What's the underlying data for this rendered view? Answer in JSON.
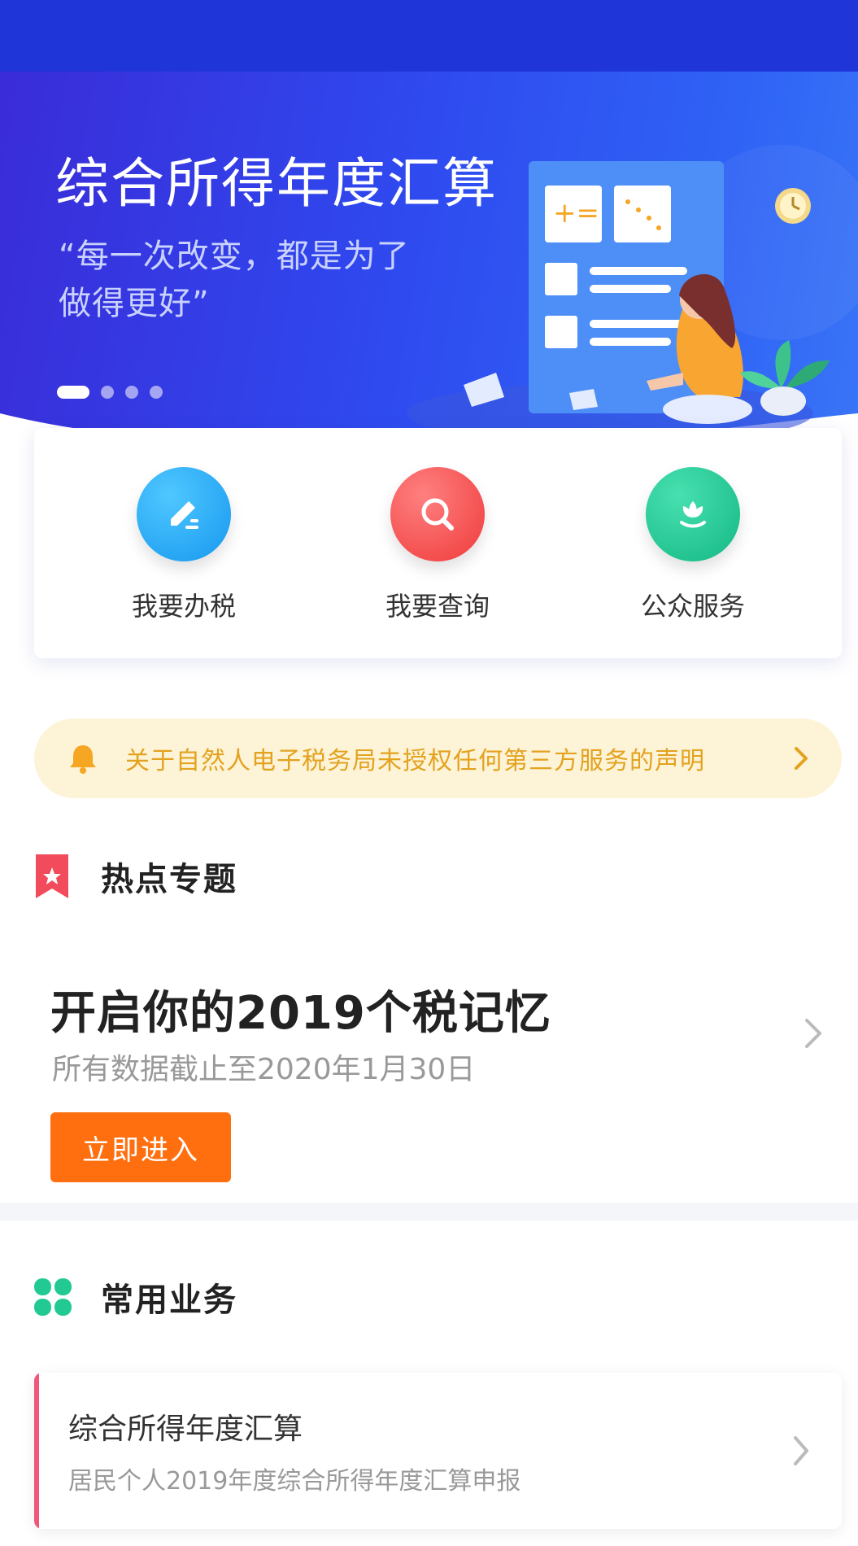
{
  "banner": {
    "title": "综合所得年度汇算",
    "quote": "“每一次改变，都是为了做得更好”",
    "dots_count": 4,
    "active_dot": 0
  },
  "services": [
    {
      "label": "我要办税",
      "icon": "edit-icon",
      "color": "#1ea7f5"
    },
    {
      "label": "我要查询",
      "icon": "search-icon",
      "color": "#f24b4b"
    },
    {
      "label": "公众服务",
      "icon": "flower-icon",
      "color": "#20c997"
    }
  ],
  "notice": {
    "text": "关于自然人电子税务局未授权任何第三方服务的声明",
    "icon": "bell-icon",
    "color": "#e3a21f"
  },
  "hot_topics": {
    "section_title": "热点专题",
    "headline": "开启你的2019个税记忆",
    "subtitle": "所有数据截止至2020年1月30日",
    "button_label": "立即进入"
  },
  "common_business": {
    "section_title": "常用业务",
    "items": [
      {
        "name": "综合所得年度汇算",
        "desc": "居民个人2019年度综合所得年度汇算申报"
      }
    ]
  },
  "colors": {
    "primary_blue": "#2f49ef",
    "orange": "#ff6f0f",
    "accent_pink": "#f0577a"
  }
}
